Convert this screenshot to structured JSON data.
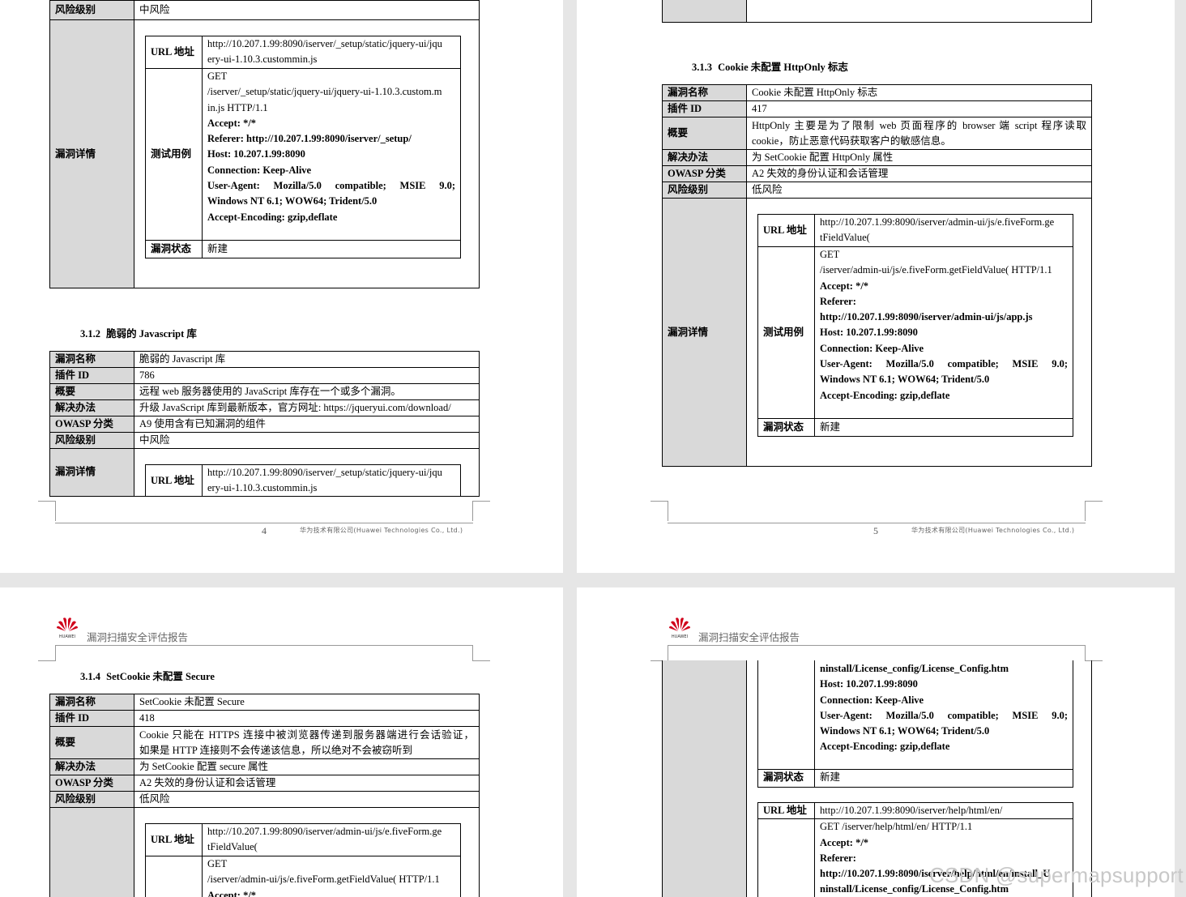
{
  "labels": {
    "name": "漏洞名称",
    "plugin_id": "插件 ID",
    "summary": "概要",
    "solution": "解决办法",
    "owasp": "OWASP 分类",
    "risk": "风险级别",
    "details": "漏洞详情",
    "url": "URL 地址",
    "test_case": "测试用例",
    "status": "漏洞状态"
  },
  "header_title": "漏洞扫描安全评估报告",
  "logo_text": "HUAWEI",
  "footer_company": "华为技术有限公司(Huawei Technologies Co., Ltd.)",
  "page4": {
    "top_risk": "中风险",
    "top_url": [
      "http://10.207.1.99:8090/iserver/_setup/static/jquery-ui/jqu",
      "ery-ui-1.10.3.custommin.js"
    ],
    "top_test": [
      "GET",
      "/iserver/_setup/static/jquery-ui/jquery-ui-1.10.3.custom.m",
      "in.js HTTP/1.1",
      "Accept: */*",
      "Referer: http://10.207.1.99:8090/iserver/_setup/",
      "Host: 10.207.1.99:8090",
      "Connection: Keep-Alive",
      "User-Agent:   Mozilla/5.0   compatible;   MSIE   9.0;",
      "Windows NT 6.1; WOW64; Trident/5.0",
      "Accept-Encoding: gzip,deflate"
    ],
    "top_status": "新建",
    "section_num": "3.1.2",
    "section_title": "脆弱的 Javascript 库",
    "name": "脆弱的 Javascript 库",
    "plugin_id": "786",
    "summary": "远程 web 服务器使用的 JavaScript 库存在一个或多个漏洞。",
    "solution": "升级 JavaScript 库到最新版本，官方网址: https://jqueryui.com/download/",
    "owasp": "A9  使用含有已知漏洞的组件",
    "risk": "中风险",
    "url": [
      "http://10.207.1.99:8090/iserver/_setup/static/jquery-ui/jqu",
      "ery-ui-1.10.3.custommin.js"
    ],
    "page_number": "4"
  },
  "page5": {
    "section_num": "3.1.3",
    "section_title": "Cookie 未配置 HttpOnly 标志",
    "name": "Cookie 未配置 HttpOnly 标志",
    "plugin_id": "417",
    "summary": [
      "HttpOnly 主要是为了限制 web 页面程序的 browser 端 script 程序读取",
      "cookie，防止恶意代码获取客户的敏感信息。"
    ],
    "solution": "为 SetCookie 配置 HttpOnly 属性",
    "owasp": "A2  失效的身份认证和会话管理",
    "risk": "低风险",
    "url": [
      "http://10.207.1.99:8090/iserver/admin-ui/js/e.fiveForm.ge",
      "tFieldValue("
    ],
    "test": [
      "GET",
      "/iserver/admin-ui/js/e.fiveForm.getFieldValue( HTTP/1.1",
      "Accept: */*",
      "Referer:",
      "http://10.207.1.99:8090/iserver/admin-ui/js/app.js",
      "Host: 10.207.1.99:8090",
      "Connection: Keep-Alive",
      "User-Agent:   Mozilla/5.0   compatible;   MSIE   9.0;",
      "Windows NT 6.1; WOW64; Trident/5.0",
      "Accept-Encoding: gzip,deflate"
    ],
    "status": "新建",
    "page_number": "5"
  },
  "page6": {
    "section_num": "3.1.4",
    "section_title": "SetCookie 未配置 Secure",
    "name": "SetCookie 未配置 Secure",
    "plugin_id": "418",
    "summary": [
      "Cookie 只能在 HTTPS 连接中被浏览器传递到服务器端进行会话验证，",
      "如果是 HTTP 连接则不会传递该信息，所以绝对不会被窃听到"
    ],
    "solution": "为 SetCookie 配置 secure 属性",
    "owasp": "A2  失效的身份认证和会话管理",
    "risk": "低风险",
    "url": [
      "http://10.207.1.99:8090/iserver/admin-ui/js/e.fiveForm.ge",
      "tFieldValue("
    ],
    "test": [
      "GET",
      "/iserver/admin-ui/js/e.fiveForm.getFieldValue( HTTP/1.1",
      "Accept: */*"
    ]
  },
  "page7": {
    "test_cont": [
      "ninstall/License_config/License_Config.htm",
      "Host: 10.207.1.99:8090",
      "Connection: Keep-Alive",
      "User-Agent:   Mozilla/5.0   compatible;   MSIE   9.0;",
      "Windows NT 6.1; WOW64; Trident/5.0",
      "Accept-Encoding: gzip,deflate"
    ],
    "status": "新建",
    "url2": "http://10.207.1.99:8090/iserver/help/html/en/",
    "test2": [
      "GET /iserver/help/html/en/ HTTP/1.1",
      "Accept: */*",
      "Referer:",
      "http://10.207.1.99:8090/iserver/help/html/en/install_U",
      "ninstall/License_config/License_Config.htm"
    ]
  },
  "watermark": "CSDN @supermapsupport"
}
